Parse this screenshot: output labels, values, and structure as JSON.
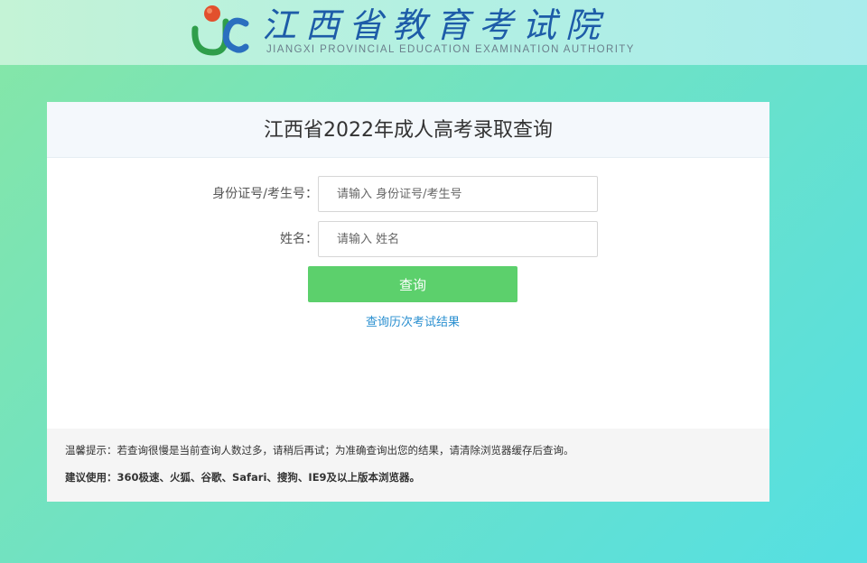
{
  "header": {
    "logo_cn": "江西省教育考试院",
    "logo_en": "JIANGXI PROVINCIAL EDUCATION EXAMINATION AUTHORITY"
  },
  "panel": {
    "title": "江西省2022年成人高考录取查询"
  },
  "form": {
    "id_label": "身份证号/考生号：",
    "id_placeholder": "请输入 身份证号/考生号",
    "name_label": "姓名：",
    "name_placeholder": "请输入 姓名",
    "submit_label": "查询",
    "history_link": "查询历次考试结果"
  },
  "tips": {
    "notice": "温馨提示：若查询很慢是当前查询人数过多，请稍后再试；为准确查询出您的结果，请清除浏览器缓存后查询。",
    "browsers": "建议使用：360极速、火狐、谷歌、Safari、搜狗、IE9及以上版本浏览器。"
  },
  "colors": {
    "submit_button": "#5cd06c",
    "link": "#2a8fd0",
    "logo_text": "#1d5ca8"
  }
}
